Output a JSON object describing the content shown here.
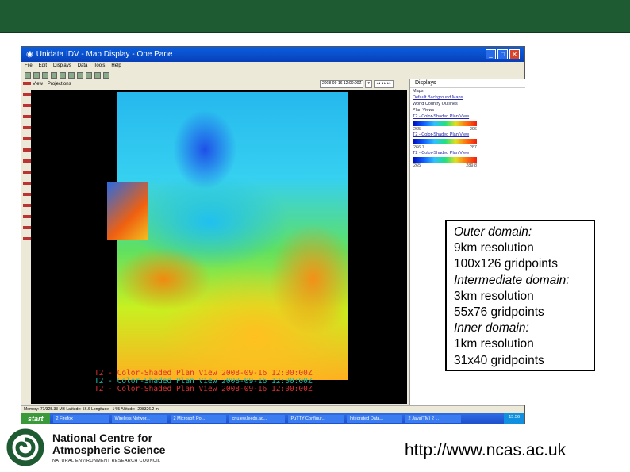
{
  "window": {
    "title": "Unidata IDV - Map Display - One Pane",
    "menu": [
      "File",
      "Edit",
      "Displays",
      "Data",
      "Tools",
      "Help"
    ],
    "view_menu": [
      "View",
      "Projections"
    ],
    "time_value": "2008-09-16 12:00:00Z",
    "map_labels": [
      {
        "text": "T2 - Color-Shaded Plan View 2008-09-16 12:00:00Z",
        "color": "#e03030"
      },
      {
        "text": "T2 - Color-Shaded Plan View 2008-09-16 12:00:00Z",
        "color": "#20c0b0"
      },
      {
        "text": "T2 - Color-Shaded Plan View 2008-09-16 12:00:00Z",
        "color": "#e03030"
      }
    ],
    "status": "Memory: 71/325.33 MB   Latitude: 56.6 Longitude: -14.5 Altitude: -298326.2 m"
  },
  "panel": {
    "header": "Displays",
    "maps_label": "Maps",
    "map_item": "Default Background Maps",
    "map_sub": "World Country Outlines",
    "plan_label": "Plan Views",
    "plan_items": [
      {
        "label": "T2 - Color-Shaded Plan View",
        "min": "265",
        "max": "296"
      },
      {
        "label": "T2 - Color-Shaded Plan View",
        "min": "266.7",
        "max": "287"
      },
      {
        "label": "T2 - Color-Shaded Plan View",
        "min": "265",
        "max": "289.8"
      }
    ]
  },
  "taskbar": {
    "start": "start",
    "tasks": [
      "2 Firefox",
      "Wireless Networ...",
      "2 Microsoft Po...",
      "cnu.ew.leeds.ac...",
      "PuTTY Configur...",
      "Integrated Data...",
      "2 Java(TM) 2 ..."
    ],
    "clock": "15:56"
  },
  "info": {
    "lines": [
      {
        "text": "Outer domain:",
        "italic": true
      },
      {
        "text": "9km resolution"
      },
      {
        "text": "100x126 gridpoints"
      },
      {
        "text": "Intermediate domain:",
        "italic": true
      },
      {
        "text": "3km resolution"
      },
      {
        "text": "55x76 gridpoints"
      },
      {
        "text": "Inner domain:",
        "italic": true
      },
      {
        "text": "1km resolution"
      },
      {
        "text": "31x40 gridpoints"
      }
    ]
  },
  "logo": {
    "line1": "National Centre for",
    "line2": "Atmospheric Science",
    "line3": "NATURAL ENVIRONMENT RESEARCH COUNCIL"
  },
  "url": "http://www.ncas.ac.uk",
  "colors": {
    "brand_green": "#1e5a32"
  }
}
